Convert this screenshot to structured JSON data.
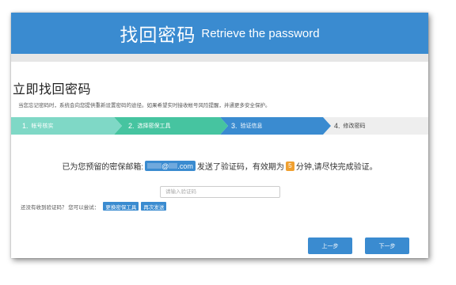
{
  "header": {
    "title_cn": "找回密码",
    "title_en": "Retrieve the password"
  },
  "page": {
    "title": "立即找回密码",
    "notice": "当您忘记密码时，系统会向您提供重新设置密码的途径。如果希望实时接收帐号风险提醒，并通更多安全保护。"
  },
  "steps": [
    {
      "num": "1.",
      "label": "帐号核实",
      "state": "done"
    },
    {
      "num": "2.",
      "label": "选择密保工具",
      "state": "done"
    },
    {
      "num": "3.",
      "label": "验证信息",
      "state": "current"
    },
    {
      "num": "4.",
      "label": "修改密码",
      "state": "pending"
    }
  ],
  "verify": {
    "text_before": "已为您预留的密保邮箱:",
    "email_at": "@",
    "email_domain": ".com",
    "text_middle": "发送了验证码，有效期为",
    "minutes": "5",
    "text_after": "分钟,请尽快完成验证。",
    "code_placeholder": "请输入验证码",
    "code_value": ""
  },
  "retry": {
    "prompt": "还没有收到验证码？ 您可以尝试：",
    "change_tool_label": "更换密保工具",
    "resend_label": "再次发送"
  },
  "nav": {
    "prev_label": "上一步",
    "next_label": "下一步"
  },
  "colors": {
    "brand_blue": "#3a8bd0",
    "step_done_light": "#7fd8c6",
    "step_done": "#46c4a0",
    "step_pending": "#eeeeee",
    "minutes_badge": "#f0a030"
  }
}
